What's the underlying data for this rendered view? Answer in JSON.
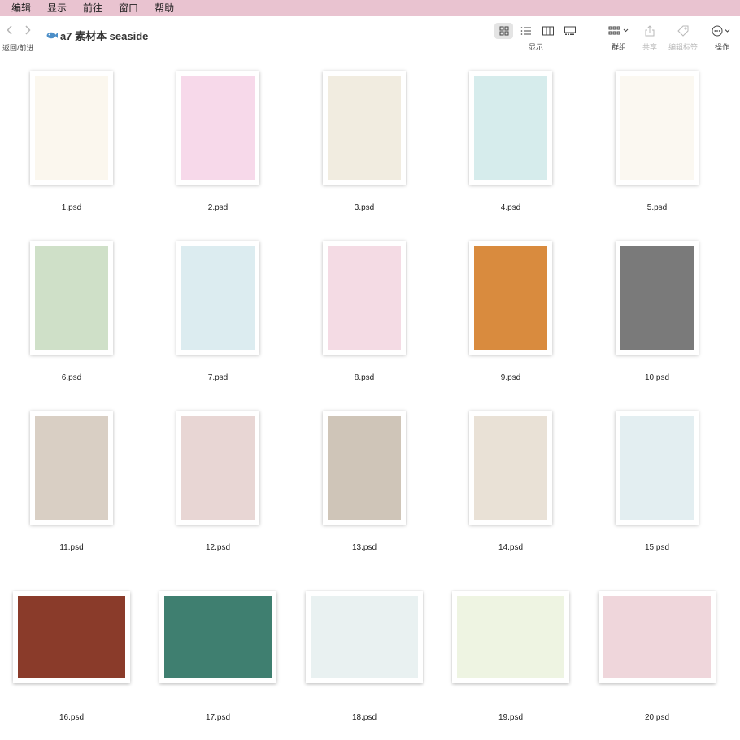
{
  "menubar": {
    "items": [
      "编辑",
      "显示",
      "前往",
      "窗口",
      "帮助"
    ]
  },
  "toolbar": {
    "nav_label": "返回/前进",
    "folder_title": "a7 素材本 seaside",
    "view_label": "显示",
    "group_label": "群组",
    "share_label": "共享",
    "tags_label": "编辑标签",
    "actions_label": "操作"
  },
  "files": [
    {
      "name": "1.psd",
      "bg": "#fbf7ee"
    },
    {
      "name": "2.psd",
      "bg": "#f7d9ea"
    },
    {
      "name": "3.psd",
      "bg": "#f1ece0"
    },
    {
      "name": "4.psd",
      "bg": "#d6ecec"
    },
    {
      "name": "5.psd",
      "bg": "#fbf8f1"
    },
    {
      "name": "6.psd",
      "bg": "#cfe0c8"
    },
    {
      "name": "7.psd",
      "bg": "#dcecf0"
    },
    {
      "name": "8.psd",
      "bg": "#f4dbe4"
    },
    {
      "name": "9.psd",
      "bg": "#d98b3e"
    },
    {
      "name": "10.psd",
      "bg": "#7a7a7a"
    },
    {
      "name": "11.psd",
      "bg": "#d9cfc4"
    },
    {
      "name": "12.psd",
      "bg": "#e8d6d4"
    },
    {
      "name": "13.psd",
      "bg": "#cfc5b8"
    },
    {
      "name": "14.psd",
      "bg": "#e9e1d6"
    },
    {
      "name": "15.psd",
      "bg": "#e3eef1"
    },
    {
      "name": "16.psd",
      "bg": "#8a3b2a"
    },
    {
      "name": "17.psd",
      "bg": "#3f7f70"
    },
    {
      "name": "18.psd",
      "bg": "#e9f1f1"
    },
    {
      "name": "19.psd",
      "bg": "#eef4e2"
    },
    {
      "name": "20.psd",
      "bg": "#efd6db"
    }
  ]
}
